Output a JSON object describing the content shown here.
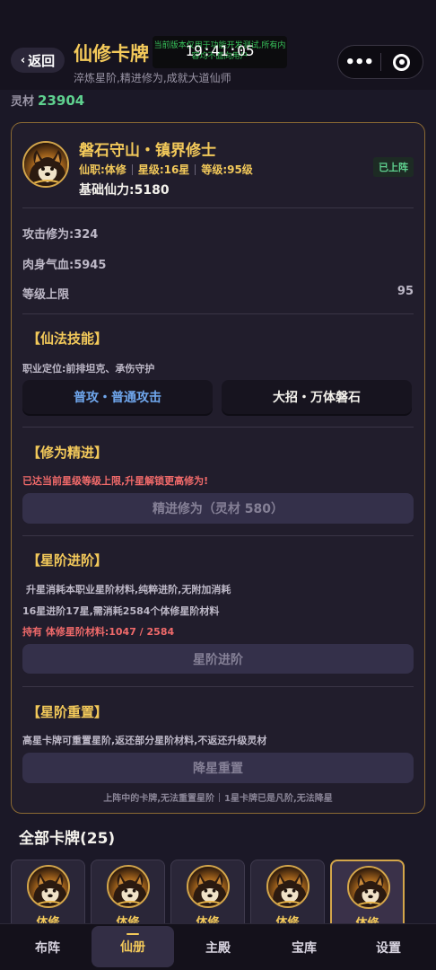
{
  "nav": {
    "back_label": "返回",
    "title": "仙修卡牌",
    "subtitle": "淬炼星阶,精进修为,成就大道仙师",
    "dev_notice": "当前版本仅用于功能开发测试,所有内容均不面向用户",
    "time": "19:41:05"
  },
  "resource": {
    "label": "灵材",
    "value": "23904"
  },
  "card": {
    "name": "磐石守山・镇界修士",
    "class_text": "仙职:体修",
    "star_text": "星级:16星",
    "level_text": "等级:95级",
    "base_power": "基础仙力:5180",
    "status_badge": "已上阵",
    "stats": {
      "attack": "攻击修为:324",
      "hp": "肉身气血:5945",
      "level_cap_label": "等级上限",
      "level_cap_value": "95"
    }
  },
  "skills": {
    "title": "【仙法技能】",
    "role": "职业定位:前排坦克、承伤守护",
    "basic": "普攻・普通攻击",
    "ultimate": "大招・万体磐石"
  },
  "cultivation": {
    "title": "【修为精进】",
    "warning": "已达当前星级等级上限,升星解锁更高修为!",
    "button": "精进修为（灵材 580）"
  },
  "star_advance": {
    "title": "【星阶进阶】",
    "desc1": "升星消耗本职业星阶材料,纯粹进阶,无附加消耗",
    "desc2": "16星进阶17星,需消耗2584个体修星阶材料",
    "owned": "持有 体修星阶材料:1047 / 2584",
    "button": "星阶进阶"
  },
  "star_reset": {
    "title": "【星阶重置】",
    "desc": "高星卡牌可重置星阶,返还部分星阶材料,不返还升级灵材",
    "button": "降星重置",
    "foot_a": "上阵中的卡牌,无法重置星阶",
    "foot_b": "1星卡牌已是凡阶,无法降星"
  },
  "all_cards": {
    "title": "全部卡牌(25)",
    "items": [
      {
        "label": "体修"
      },
      {
        "label": "体修"
      },
      {
        "label": "体修"
      },
      {
        "label": "体修"
      },
      {
        "label": "体修"
      }
    ]
  },
  "tabs": [
    "布阵",
    "仙册",
    "主殿",
    "宝库",
    "设置"
  ],
  "colors": {
    "gold": "#f3c95a",
    "green": "#5fd18f",
    "red": "#f06a6a",
    "blue": "#6fa6ec",
    "bg": "#1b1827"
  },
  "icons": {
    "back": "chevron-left-icon",
    "menu": "more-dots-icon",
    "close": "target-circle-icon",
    "avatar": "shiba-warrior-avatar"
  }
}
